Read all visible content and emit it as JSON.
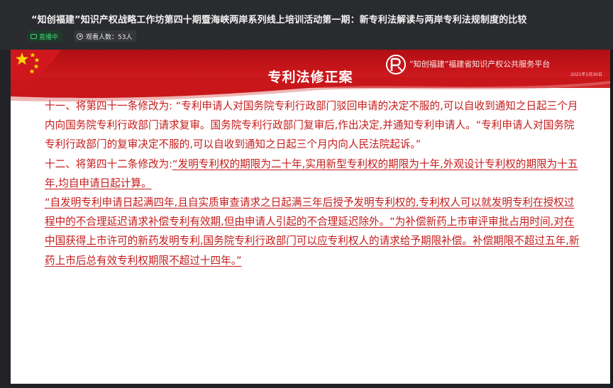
{
  "header": {
    "title": "“知创福建”知识产权战略工作坊第四十期暨海峡两岸系列线上培训活动第一期：新专利法解读与两岸专利法规制度的比较",
    "live_label": "直播中",
    "viewers_label": "观看人数：53人"
  },
  "slide": {
    "title": "专利法修正案",
    "org_name": "“知创福建”福建省知识产权公共服务平台",
    "org_date": "2021年1月30日",
    "paragraphs": {
      "p11": "十一、将第四十一条修改为: “专利申请人对国务院专利行政部门驳回申请的决定不服的,可以自收到通知之日起三个月内向国务院专利行政部门请求复审。国务院专利行政部门复审后,作出决定,并通知专利申请人。“专利申请人对国务院专利行政部门的复审决定不服的,可以自收到通知之日起三个月内向人民法院起诉。”",
      "p12_prefix": "十二、将第四十二条修改为:",
      "p12_underlined": "“发明专利权的期限为二十年,实用新型专利权的期限为十年,外观设计专利权的期限为十五年,均自申请日起计算。",
      "p12_cont": "“自发明专利申请日起满四年,且自实质审查请求之日起满三年后授予发明专利权的,专利权人可以就发明专利在授权过程中的不合理延迟请求补偿专利有效期,但由申请人引起的不合理延迟除外。“为补偿新药上市审评审批占用时间,对在中国获得上市许可的新药发明专利,国务院专利行政部门可以应专利权人的请求给予期限补偿。补偿期限不超过五年,新药上市后总有效专利权期限不超过十四年。”"
    }
  },
  "colors": {
    "banner_red": "#c8161b",
    "text_red": "#c51a1a",
    "live_green": "#3fd37a"
  }
}
